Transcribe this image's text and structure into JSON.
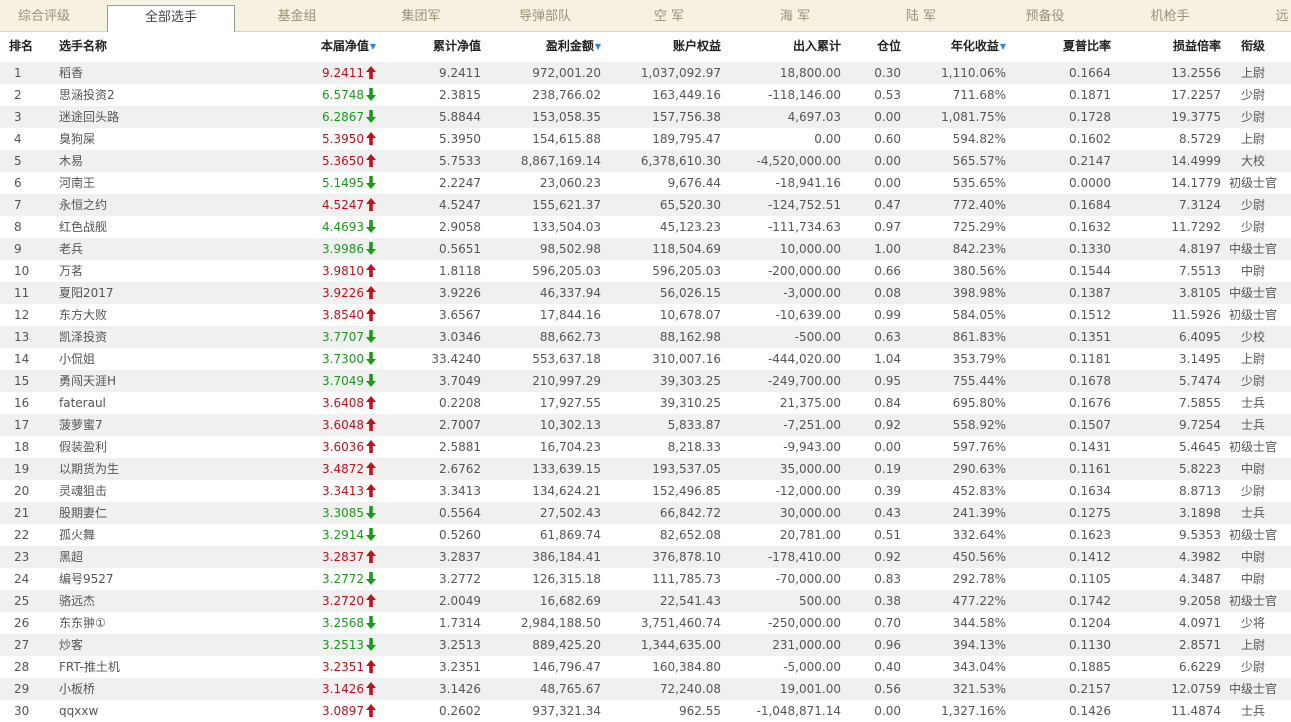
{
  "tabs": [
    {
      "label": "综合评级",
      "active": false
    },
    {
      "label": "全部选手",
      "active": true
    },
    {
      "label": "基金组",
      "active": false
    },
    {
      "label": "集团军",
      "active": false
    },
    {
      "label": "导弹部队",
      "active": false
    },
    {
      "label": "空  军",
      "active": false
    },
    {
      "label": "海  军",
      "active": false
    },
    {
      "label": "陆  军",
      "active": false
    },
    {
      "label": "预备役",
      "active": false
    },
    {
      "label": "机枪手",
      "active": false
    },
    {
      "label": "远",
      "active": false
    }
  ],
  "columns": [
    {
      "key": "rank",
      "label": "排名",
      "sortable": false
    },
    {
      "key": "name",
      "label": "选手名称",
      "sortable": false
    },
    {
      "key": "nav",
      "label": "本届净值",
      "sortable": true
    },
    {
      "key": "cum_nav",
      "label": "累计净值",
      "sortable": false
    },
    {
      "key": "profit",
      "label": "盈利金额",
      "sortable": true
    },
    {
      "key": "equity",
      "label": "账户权益",
      "sortable": false
    },
    {
      "key": "flow",
      "label": "出入累计",
      "sortable": false
    },
    {
      "key": "position",
      "label": "仓位",
      "sortable": false
    },
    {
      "key": "annual",
      "label": "年化收益",
      "sortable": true
    },
    {
      "key": "sharpe",
      "label": "夏普比率",
      "sortable": false
    },
    {
      "key": "pl_ratio",
      "label": "损益倍率",
      "sortable": false
    },
    {
      "key": "rank_title",
      "label": "衔级",
      "sortable": false
    }
  ],
  "colors": {
    "up": "#c1121c",
    "down": "#1b9a1b",
    "sort_indicator": "#2b8ad6",
    "row_alt": "#f0f0f0",
    "tab_bar": "#f6f1e0"
  },
  "rows": [
    {
      "rank": "1",
      "name": "稻香",
      "nav": "9.2411",
      "trend": "up",
      "cum_nav": "9.2411",
      "profit": "972,001.20",
      "equity": "1,037,092.97",
      "flow": "18,800.00",
      "position": "0.30",
      "annual": "1,110.06%",
      "sharpe": "0.1664",
      "pl_ratio": "13.2556",
      "rank_title": "上尉"
    },
    {
      "rank": "2",
      "name": "思涵投资2",
      "nav": "6.5748",
      "trend": "down",
      "cum_nav": "2.3815",
      "profit": "238,766.02",
      "equity": "163,449.16",
      "flow": "-118,146.00",
      "position": "0.53",
      "annual": "711.68%",
      "sharpe": "0.1871",
      "pl_ratio": "17.2257",
      "rank_title": "少尉"
    },
    {
      "rank": "3",
      "name": "迷途回头路",
      "nav": "6.2867",
      "trend": "down",
      "cum_nav": "5.8844",
      "profit": "153,058.35",
      "equity": "157,756.38",
      "flow": "4,697.03",
      "position": "0.00",
      "annual": "1,081.75%",
      "sharpe": "0.1728",
      "pl_ratio": "19.3775",
      "rank_title": "少尉"
    },
    {
      "rank": "4",
      "name": "臭狗屎",
      "nav": "5.3950",
      "trend": "up",
      "cum_nav": "5.3950",
      "profit": "154,615.88",
      "equity": "189,795.47",
      "flow": "0.00",
      "position": "0.60",
      "annual": "594.82%",
      "sharpe": "0.1602",
      "pl_ratio": "8.5729",
      "rank_title": "上尉"
    },
    {
      "rank": "5",
      "name": "木易",
      "nav": "5.3650",
      "trend": "up",
      "cum_nav": "5.7533",
      "profit": "8,867,169.14",
      "equity": "6,378,610.30",
      "flow": "-4,520,000.00",
      "position": "0.00",
      "annual": "565.57%",
      "sharpe": "0.2147",
      "pl_ratio": "14.4999",
      "rank_title": "大校"
    },
    {
      "rank": "6",
      "name": "河南王",
      "nav": "5.1495",
      "trend": "down",
      "cum_nav": "2.2247",
      "profit": "23,060.23",
      "equity": "9,676.44",
      "flow": "-18,941.16",
      "position": "0.00",
      "annual": "535.65%",
      "sharpe": "0.0000",
      "pl_ratio": "14.1779",
      "rank_title": "初级士官"
    },
    {
      "rank": "7",
      "name": "永恒之约",
      "nav": "4.5247",
      "trend": "up",
      "cum_nav": "4.5247",
      "profit": "155,621.37",
      "equity": "65,520.30",
      "flow": "-124,752.51",
      "position": "0.47",
      "annual": "772.40%",
      "sharpe": "0.1684",
      "pl_ratio": "7.3124",
      "rank_title": "少尉"
    },
    {
      "rank": "8",
      "name": "红色战舰",
      "nav": "4.4693",
      "trend": "down",
      "cum_nav": "2.9058",
      "profit": "133,504.03",
      "equity": "45,123.23",
      "flow": "-111,734.63",
      "position": "0.97",
      "annual": "725.29%",
      "sharpe": "0.1632",
      "pl_ratio": "11.7292",
      "rank_title": "少尉"
    },
    {
      "rank": "9",
      "name": "老兵",
      "nav": "3.9986",
      "trend": "down",
      "cum_nav": "0.5651",
      "profit": "98,502.98",
      "equity": "118,504.69",
      "flow": "10,000.00",
      "position": "1.00",
      "annual": "842.23%",
      "sharpe": "0.1330",
      "pl_ratio": "4.8197",
      "rank_title": "中级士官"
    },
    {
      "rank": "10",
      "name": "万茗",
      "nav": "3.9810",
      "trend": "up",
      "cum_nav": "1.8118",
      "profit": "596,205.03",
      "equity": "596,205.03",
      "flow": "-200,000.00",
      "position": "0.66",
      "annual": "380.56%",
      "sharpe": "0.1544",
      "pl_ratio": "7.5513",
      "rank_title": "中尉"
    },
    {
      "rank": "11",
      "name": "夏阳2017",
      "nav": "3.9226",
      "trend": "up",
      "cum_nav": "3.9226",
      "profit": "46,337.94",
      "equity": "56,026.15",
      "flow": "-3,000.00",
      "position": "0.08",
      "annual": "398.98%",
      "sharpe": "0.1387",
      "pl_ratio": "3.8105",
      "rank_title": "中级士官"
    },
    {
      "rank": "12",
      "name": "东方大败",
      "nav": "3.8540",
      "trend": "up",
      "cum_nav": "3.6567",
      "profit": "17,844.16",
      "equity": "10,678.07",
      "flow": "-10,639.00",
      "position": "0.99",
      "annual": "584.05%",
      "sharpe": "0.1512",
      "pl_ratio": "11.5926",
      "rank_title": "初级士官"
    },
    {
      "rank": "13",
      "name": "凯泽投资",
      "nav": "3.7707",
      "trend": "down",
      "cum_nav": "3.0346",
      "profit": "88,662.73",
      "equity": "88,162.98",
      "flow": "-500.00",
      "position": "0.63",
      "annual": "861.83%",
      "sharpe": "0.1351",
      "pl_ratio": "6.4095",
      "rank_title": "少校"
    },
    {
      "rank": "14",
      "name": "小侃姐",
      "nav": "3.7300",
      "trend": "down",
      "cum_nav": "33.4240",
      "profit": "553,637.18",
      "equity": "310,007.16",
      "flow": "-444,020.00",
      "position": "1.04",
      "annual": "353.79%",
      "sharpe": "0.1181",
      "pl_ratio": "3.1495",
      "rank_title": "上尉"
    },
    {
      "rank": "15",
      "name": "勇闯天涯H",
      "nav": "3.7049",
      "trend": "down",
      "cum_nav": "3.7049",
      "profit": "210,997.29",
      "equity": "39,303.25",
      "flow": "-249,700.00",
      "position": "0.95",
      "annual": "755.44%",
      "sharpe": "0.1678",
      "pl_ratio": "5.7474",
      "rank_title": "少尉"
    },
    {
      "rank": "16",
      "name": "fateraul",
      "nav": "3.6408",
      "trend": "up",
      "cum_nav": "0.2208",
      "profit": "17,927.55",
      "equity": "39,310.25",
      "flow": "21,375.00",
      "position": "0.84",
      "annual": "695.80%",
      "sharpe": "0.1676",
      "pl_ratio": "7.5855",
      "rank_title": "士兵"
    },
    {
      "rank": "17",
      "name": "菠萝蜜7",
      "nav": "3.6048",
      "trend": "up",
      "cum_nav": "2.7007",
      "profit": "10,302.13",
      "equity": "5,833.87",
      "flow": "-7,251.00",
      "position": "0.92",
      "annual": "558.92%",
      "sharpe": "0.1507",
      "pl_ratio": "9.7254",
      "rank_title": "士兵"
    },
    {
      "rank": "18",
      "name": "假装盈利",
      "nav": "3.6036",
      "trend": "up",
      "cum_nav": "2.5881",
      "profit": "16,704.23",
      "equity": "8,218.33",
      "flow": "-9,943.00",
      "position": "0.00",
      "annual": "597.76%",
      "sharpe": "0.1431",
      "pl_ratio": "5.4645",
      "rank_title": "初级士官"
    },
    {
      "rank": "19",
      "name": "以期货为生",
      "nav": "3.4872",
      "trend": "up",
      "cum_nav": "2.6762",
      "profit": "133,639.15",
      "equity": "193,537.05",
      "flow": "35,000.00",
      "position": "0.19",
      "annual": "290.63%",
      "sharpe": "0.1161",
      "pl_ratio": "5.8223",
      "rank_title": "中尉"
    },
    {
      "rank": "20",
      "name": "灵魂狙击",
      "nav": "3.3413",
      "trend": "up",
      "cum_nav": "3.3413",
      "profit": "134,624.21",
      "equity": "152,496.85",
      "flow": "-12,000.00",
      "position": "0.39",
      "annual": "452.83%",
      "sharpe": "0.1634",
      "pl_ratio": "8.8713",
      "rank_title": "少尉"
    },
    {
      "rank": "21",
      "name": "股期妻仁",
      "nav": "3.3085",
      "trend": "down",
      "cum_nav": "0.5564",
      "profit": "27,502.43",
      "equity": "66,842.72",
      "flow": "30,000.00",
      "position": "0.43",
      "annual": "241.39%",
      "sharpe": "0.1275",
      "pl_ratio": "3.1898",
      "rank_title": "士兵"
    },
    {
      "rank": "22",
      "name": "孤火舞",
      "nav": "3.2914",
      "trend": "down",
      "cum_nav": "0.5260",
      "profit": "61,869.74",
      "equity": "82,652.08",
      "flow": "20,781.00",
      "position": "0.51",
      "annual": "332.64%",
      "sharpe": "0.1623",
      "pl_ratio": "9.5353",
      "rank_title": "初级士官"
    },
    {
      "rank": "23",
      "name": "黑超",
      "nav": "3.2837",
      "trend": "up",
      "cum_nav": "3.2837",
      "profit": "386,184.41",
      "equity": "376,878.10",
      "flow": "-178,410.00",
      "position": "0.92",
      "annual": "450.56%",
      "sharpe": "0.1412",
      "pl_ratio": "4.3982",
      "rank_title": "中尉"
    },
    {
      "rank": "24",
      "name": "编号9527",
      "nav": "3.2772",
      "trend": "down",
      "cum_nav": "3.2772",
      "profit": "126,315.18",
      "equity": "111,785.73",
      "flow": "-70,000.00",
      "position": "0.83",
      "annual": "292.78%",
      "sharpe": "0.1105",
      "pl_ratio": "4.3487",
      "rank_title": "中尉"
    },
    {
      "rank": "25",
      "name": "骆远杰",
      "nav": "3.2720",
      "trend": "up",
      "cum_nav": "2.0049",
      "profit": "16,682.69",
      "equity": "22,541.43",
      "flow": "500.00",
      "position": "0.38",
      "annual": "477.22%",
      "sharpe": "0.1742",
      "pl_ratio": "9.2058",
      "rank_title": "初级士官"
    },
    {
      "rank": "26",
      "name": "东东翀①",
      "nav": "3.2568",
      "trend": "down",
      "cum_nav": "1.7314",
      "profit": "2,984,188.50",
      "equity": "3,751,460.74",
      "flow": "-250,000.00",
      "position": "0.70",
      "annual": "344.58%",
      "sharpe": "0.1204",
      "pl_ratio": "4.0971",
      "rank_title": "少将"
    },
    {
      "rank": "27",
      "name": "炒客",
      "nav": "3.2513",
      "trend": "down",
      "cum_nav": "3.2513",
      "profit": "889,425.20",
      "equity": "1,344,635.00",
      "flow": "231,000.00",
      "position": "0.96",
      "annual": "394.13%",
      "sharpe": "0.1130",
      "pl_ratio": "2.8571",
      "rank_title": "上尉"
    },
    {
      "rank": "28",
      "name": "FRT-推土机",
      "nav": "3.2351",
      "trend": "up",
      "cum_nav": "3.2351",
      "profit": "146,796.47",
      "equity": "160,384.80",
      "flow": "-5,000.00",
      "position": "0.40",
      "annual": "343.04%",
      "sharpe": "0.1885",
      "pl_ratio": "6.6229",
      "rank_title": "少尉"
    },
    {
      "rank": "29",
      "name": "小板桥",
      "nav": "3.1426",
      "trend": "up",
      "cum_nav": "3.1426",
      "profit": "48,765.67",
      "equity": "72,240.08",
      "flow": "19,001.00",
      "position": "0.56",
      "annual": "321.53%",
      "sharpe": "0.2157",
      "pl_ratio": "12.0759",
      "rank_title": "中级士官"
    },
    {
      "rank": "30",
      "name": "qqxxw",
      "nav": "3.0897",
      "trend": "up",
      "cum_nav": "0.2602",
      "profit": "937,321.34",
      "equity": "962.55",
      "flow": "-1,048,871.14",
      "position": "0.00",
      "annual": "1,327.16%",
      "sharpe": "0.1426",
      "pl_ratio": "11.4874",
      "rank_title": "士兵"
    }
  ]
}
